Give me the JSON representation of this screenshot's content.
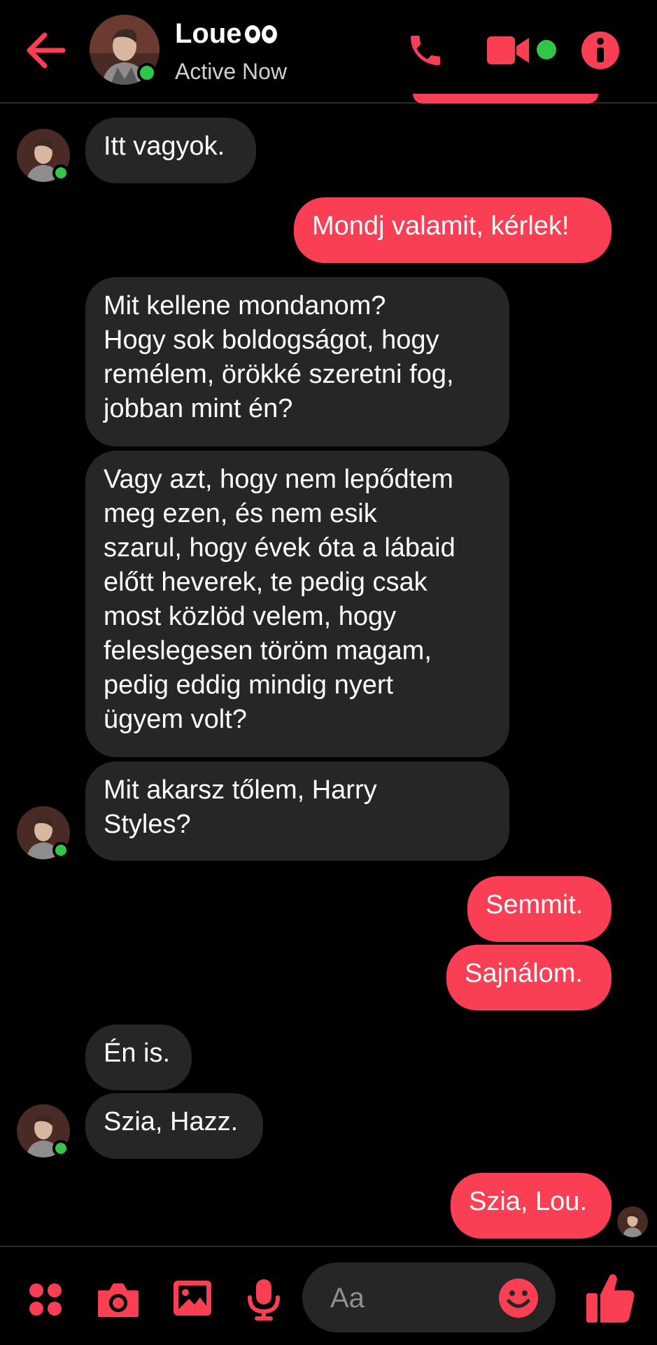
{
  "header": {
    "name": "Loue",
    "status": "Active Now",
    "back_icon": "arrow-left-icon",
    "call_icon": "phone-icon",
    "video_icon": "video-camera-icon",
    "info_icon": "info-icon",
    "accent_color": "#fa3e54",
    "online_color": "#31c54a"
  },
  "messages": [
    {
      "text": "Itt vagyok.",
      "from": "them"
    },
    {
      "text": "Mondj valamit, kérlek!",
      "from": "me"
    },
    {
      "text": "Mit kellene mondanom?\nHogy sok boldogságot, hogy\nremélem, örökké szeretni fog,\njobban mint én?",
      "from": "them"
    },
    {
      "text": "Vagy azt, hogy nem lepődtem\nmeg ezen, és nem esik\nszarul, hogy évek óta a lábaid\nelőtt heverek, te pedig csak\nmost közlöd velem, hogy\nfeleslegesen töröm magam,\npedig eddig mindig nyert\nügyem volt?",
      "from": "them"
    },
    {
      "text": "Mit akarsz tőlem, Harry\nStyles?",
      "from": "them"
    },
    {
      "text": "Semmit.",
      "from": "me"
    },
    {
      "text": "Sajnálom.",
      "from": "me"
    },
    {
      "text": "Én is.",
      "from": "them"
    },
    {
      "text": "Szia, Hazz.",
      "from": "them"
    },
    {
      "text": "Szia, Lou.",
      "from": "me"
    }
  ],
  "composer": {
    "placeholder": "Aa",
    "icons": [
      "apps-icon",
      "camera-icon",
      "gallery-icon",
      "microphone-icon",
      "emoji-icon",
      "thumbs-up-icon"
    ]
  },
  "theme": {
    "background": "#000000",
    "incoming_bubble": "#262626",
    "outgoing_bubble": "#fa3e54"
  }
}
